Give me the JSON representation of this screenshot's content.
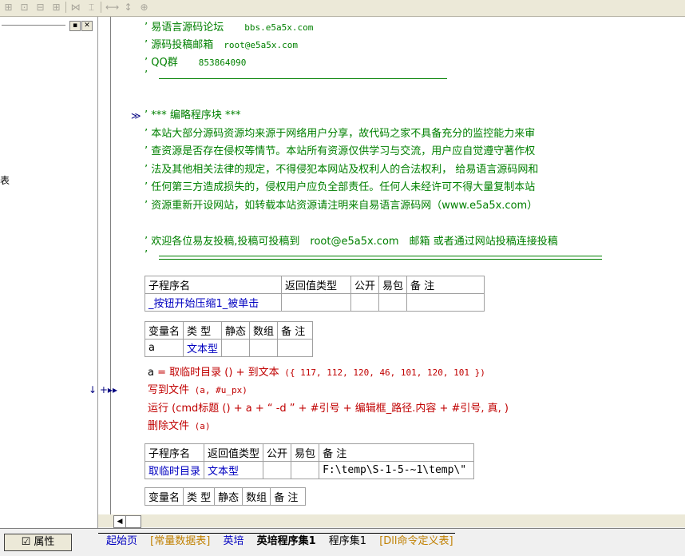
{
  "left_panel": {
    "edge_char": "表"
  },
  "header_comments": [
    {
      "label": "易语言源码论坛",
      "value": "bbs.e5a5x.com"
    },
    {
      "label": "源码投稿邮箱",
      "value": "root@e5a5x.com"
    },
    {
      "label": "QQ群",
      "value": "853864090"
    }
  ],
  "block_title": "*** 编略程序块 ***",
  "disclaimer": [
    "本站大部分源码资源均来源于网络用户分享，故代码之家不具备充分的监控能力来审",
    "查资源是否存在侵权等情节。本站所有资源仅供学习与交流，用户应自觉遵守著作权",
    "法及其他相关法律的规定，不得侵犯本网站及权利人的合法权利， 给易语言源码网和",
    "任何第三方造成损失的，侵权用户应负全部责任。任何人未经许可不得大量复制本站",
    "资源重新开设网站，如转载本站资源请注明来自易语言源码网（www.e5a5x.com）"
  ],
  "contribute_line": "欢迎各位易友投稿,投稿可投稿到　root@e5a5x.com　邮箱 或者通过网站投稿连接投稿",
  "sub1": {
    "headers": [
      "子程序名",
      "返回值类型",
      "公开",
      "易包",
      "备 注"
    ],
    "name": "_按钮开始压缩1_被单击"
  },
  "vars1": {
    "headers": [
      "变量名",
      "类 型",
      "静态",
      "数组",
      "备 注"
    ],
    "rows": [
      [
        "a",
        "文本型",
        "",
        "",
        ""
      ]
    ]
  },
  "code": {
    "l1_var": "a",
    "l1_eq": " = ",
    "l1_fn": "取临时目录",
    "l1_mid": " () + ",
    "l1_fn2": "到文本",
    "l1_args": " ({ 117, 112, 120, 46, 101, 120, 101 })",
    "l2_fn": "写到文件",
    "l2_args": " (a, #u_px)",
    "l3_fn": "运行",
    "l3_a": " (cmd标题 () + a + “ -d ” + #引号 + 编辑框_路径.内容 + #引号, 真, )",
    "l4_fn": "删除文件",
    "l4_args": " (a)",
    "markers": "↓ +▸▸"
  },
  "sub2": {
    "headers": [
      "子程序名",
      "返回值类型",
      "公开",
      "易包",
      "备 注"
    ],
    "name": "取临时目录",
    "ret": "文本型",
    "note": "F:\\temp\\S-1-5-~1\\temp\\\""
  },
  "vars2": {
    "headers": [
      "变量名",
      "类 型",
      "静态",
      "数组",
      "备 注"
    ]
  },
  "bottom": {
    "prop_button": "属性",
    "tabs": [
      "起始页",
      "[常量数据表]",
      "英培",
      "英培程序集1",
      "程序集1",
      "[Dll命令定义表]"
    ],
    "selected_tab": 3
  }
}
